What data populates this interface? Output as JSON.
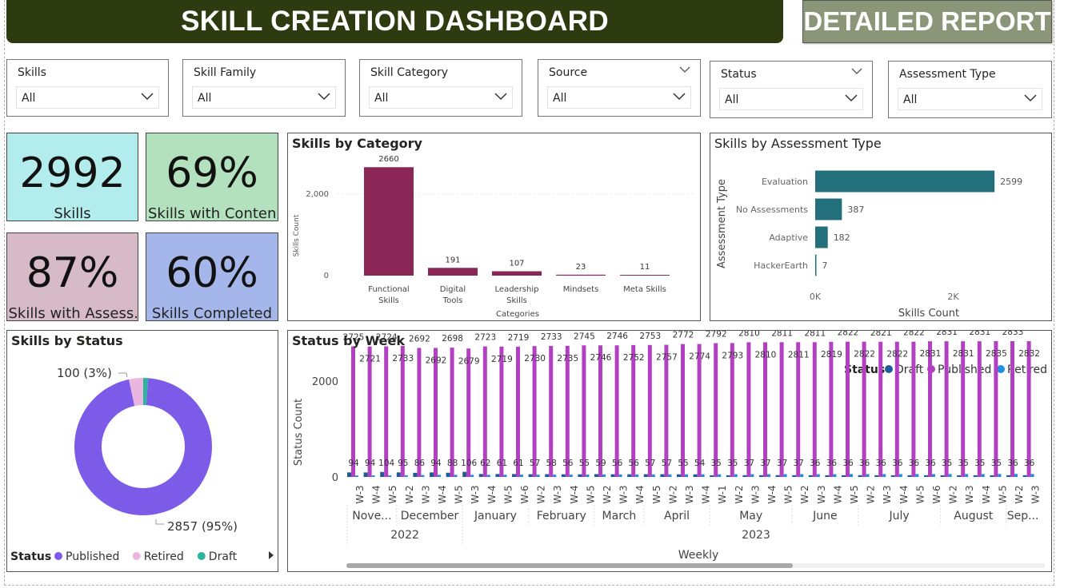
{
  "header": {
    "title": "SKILL CREATION DASHBOARD",
    "report_button": "DETAILED REPORT"
  },
  "slicers": [
    {
      "label": "Skills",
      "value": "All"
    },
    {
      "label": "Skill Family",
      "value": "All"
    },
    {
      "label": "Skill Category",
      "value": "All"
    },
    {
      "label": "Source",
      "value": "All"
    },
    {
      "label": "Status",
      "value": "All"
    },
    {
      "label": "Assessment Type",
      "value": "All"
    }
  ],
  "kpis": [
    {
      "value": "2992",
      "caption": "Skills",
      "color": "#b3ecec"
    },
    {
      "value": "69%",
      "caption": "Skills with Content",
      "color": "#b3e0bd"
    },
    {
      "value": "87%",
      "caption": "Skills with Assess...",
      "color": "#d7bac8"
    },
    {
      "value": "60%",
      "caption": "Skills Completed",
      "color": "#a5b7ea"
    }
  ],
  "colors": {
    "category_bar": "#8b2757",
    "assessment_bar": "#23707c",
    "published": "#7b5be8",
    "retired": "#e9b6e0",
    "draft": "#2bb5a0",
    "week_published": "#b33fc2",
    "week_draft": "#1e5c99",
    "week_retired": "#1a8fe3"
  },
  "chart_data": [
    {
      "type": "bar",
      "title": "Skills by Category",
      "categories": [
        "Functional Skills",
        "Digital Tools",
        "Leadership Skills",
        "Mindsets",
        "Meta Skills"
      ],
      "values": [
        2660,
        191,
        107,
        23,
        11
      ],
      "xlabel": "Categories",
      "ylabel": "Skills Count",
      "yticks": [
        "2,000",
        "0"
      ],
      "ylim": [
        0,
        2900
      ]
    },
    {
      "type": "bar",
      "orientation": "horizontal",
      "title": "Skills by Assessment Type",
      "categories": [
        "Evaluation",
        "No Assessments",
        "Adaptive",
        "HackerEarth"
      ],
      "values": [
        2599,
        387,
        182,
        7
      ],
      "xlabel": "Skills Count",
      "ylabel": "Assessment Type",
      "xticks": [
        "0K",
        "2K"
      ],
      "xlim": [
        0,
        3200
      ]
    },
    {
      "type": "pie",
      "title": "Skills by Status",
      "labels": [
        "Published",
        "Retired",
        "Draft"
      ],
      "values": [
        2857,
        100,
        35
      ],
      "data_labels": [
        "2857 (95%)",
        "100 (3%)"
      ],
      "legend_title": "Status",
      "legend_position": "bottom-left"
    },
    {
      "type": "bar",
      "title": "Status by Week",
      "legend_title": "Status",
      "legend_position": "top-right",
      "ylabel": "Status Count",
      "xlabel": "Weekly",
      "yticks": [
        "2000",
        "0"
      ],
      "ylim": [
        0,
        3000
      ],
      "weeks": [
        "W-3",
        "W-4",
        "W-5",
        "W-2",
        "W-3",
        "W-4",
        "W-5",
        "W-3",
        "W-4",
        "W-5",
        "W-6",
        "W-2",
        "W-3",
        "W-4",
        "W-5",
        "W-2",
        "W-3",
        "W-4",
        "W-5",
        "W-2",
        "W-3",
        "W-4",
        "W-1",
        "W-2",
        "W-3",
        "W-4",
        "W-5",
        "W-2",
        "W-3",
        "W-4",
        "W-5",
        "W-2",
        "W-3",
        "W-4",
        "W-5",
        "W-6",
        "W-2",
        "W-3",
        "W-4",
        "W-5",
        "W-2",
        "W-3"
      ],
      "months": [
        {
          "label": "Nove...",
          "span": 3
        },
        {
          "label": "December",
          "span": 4
        },
        {
          "label": "January",
          "span": 4
        },
        {
          "label": "February",
          "span": 4
        },
        {
          "label": "March",
          "span": 3
        },
        {
          "label": "April",
          "span": 4
        },
        {
          "label": "May",
          "span": 5
        },
        {
          "label": "June",
          "span": 4
        },
        {
          "label": "July",
          "span": 5
        },
        {
          "label": "August",
          "span": 4
        },
        {
          "label": "Sep...",
          "span": 2
        }
      ],
      "years": [
        {
          "label": "2022",
          "span": 7
        },
        {
          "label": "2023",
          "span": 35
        }
      ],
      "series": [
        {
          "name": "Published",
          "values": [
            2725,
            2721,
            2724,
            2733,
            2692,
            2692,
            2698,
            2679,
            2723,
            2719,
            2719,
            2730,
            2733,
            2735,
            2745,
            2746,
            2746,
            2752,
            2753,
            2757,
            2772,
            2774,
            2792,
            2793,
            2810,
            2810,
            2811,
            2811,
            2811,
            2819,
            2822,
            2822,
            2821,
            2822,
            2822,
            2831,
            2831,
            2831,
            2831,
            2835,
            2833,
            2832
          ]
        },
        {
          "name": "Draft",
          "values": [
            94,
            94,
            104,
            95,
            86,
            94,
            88,
            106,
            62,
            61,
            61,
            57,
            58,
            56,
            55,
            59,
            56,
            56,
            57,
            57,
            55,
            54,
            35,
            35,
            37,
            37,
            37,
            37,
            36,
            36,
            36,
            36,
            36,
            36,
            36,
            36,
            35,
            35,
            35,
            35,
            36,
            36
          ]
        },
        {
          "name": "Retired",
          "values": [
            30,
            32,
            33,
            36,
            40,
            44,
            44,
            44,
            44,
            46,
            48,
            48,
            48,
            48,
            50,
            52,
            52,
            52,
            52,
            54,
            54,
            55,
            56,
            57,
            58,
            58,
            58,
            58,
            58,
            58,
            60,
            60,
            60,
            60,
            60,
            60,
            61,
            61,
            61,
            62,
            62,
            62
          ]
        }
      ]
    }
  ]
}
